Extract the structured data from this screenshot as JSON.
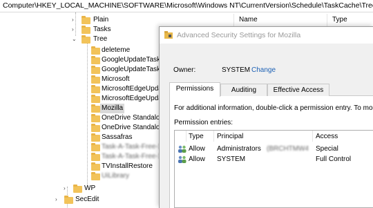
{
  "address_path": "Computer\\HKEY_LOCAL_MACHINE\\SOFTWARE\\Microsoft\\Windows NT\\CurrentVersion\\Schedule\\TaskCache\\Tree\\Mozilla",
  "tree": {
    "top": [
      {
        "label": "Plain"
      },
      {
        "label": "Tasks"
      },
      {
        "label": "Tree"
      }
    ],
    "children": [
      {
        "label": "deleteme"
      },
      {
        "label": "GoogleUpdateTaskM"
      },
      {
        "label": "GoogleUpdateTaskM"
      },
      {
        "label": "Microsoft"
      },
      {
        "label": "MicrosoftEdgeUpda"
      },
      {
        "label": "MicrosoftEdgeUpda"
      },
      {
        "label": "Mozilla"
      },
      {
        "label": "OneDrive Standalon"
      },
      {
        "label": "OneDrive Standalon"
      },
      {
        "label": "Sassafras"
      },
      {
        "label": "Task-A-Task-Free-1.0"
      },
      {
        "label": "Task-A-Task-Free-1.0"
      },
      {
        "label": "TVInstallRestore"
      },
      {
        "label": "UiLibrary"
      }
    ],
    "bottom": [
      {
        "label": "WP"
      },
      {
        "label": "SecEdit"
      }
    ]
  },
  "list_header": {
    "name": "Name",
    "type": "Type"
  },
  "dialog": {
    "title": "Advanced Security Settings for Mozilla",
    "owner_label": "Owner:",
    "owner_value": "SYSTEM",
    "change_link": "Change",
    "tabs": [
      "Permissions",
      "Auditing",
      "Effective Access"
    ],
    "info_text": "For additional information, double-click a permission entry. To modi",
    "entries_label": "Permission entries:",
    "columns": [
      "Type",
      "Principal",
      "Access"
    ],
    "entries": [
      {
        "type": "Allow",
        "principal": "Administrators",
        "principal_suffix": "(BRCHTMW4...",
        "access": "Special"
      },
      {
        "type": "Allow",
        "principal": "SYSTEM",
        "principal_suffix": "",
        "access": "Full Control"
      }
    ]
  }
}
